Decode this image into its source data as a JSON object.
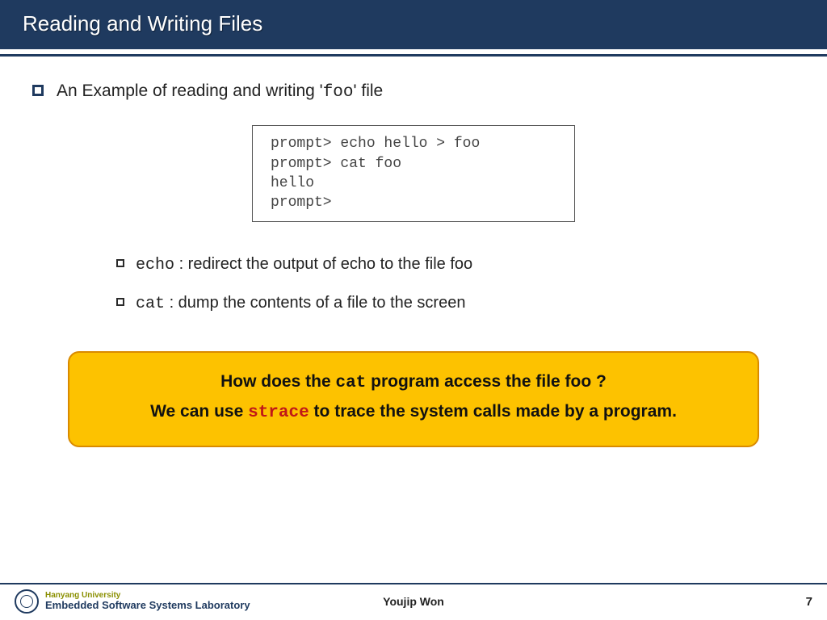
{
  "title": "Reading and Writing Files",
  "bullet": {
    "prefix": "An Example of reading and writing '",
    "code": "foo",
    "suffix": "' file"
  },
  "code_lines": [
    "prompt> echo hello > foo",
    "prompt> cat foo",
    "hello",
    "prompt>"
  ],
  "subs": [
    {
      "cmd": "echo",
      "desc": " : redirect the output of echo to the file foo"
    },
    {
      "cmd": "cat",
      "desc": " : dump the contents of a file to the screen"
    }
  ],
  "callout": {
    "line1_a": "How does the ",
    "line1_code": "cat",
    "line1_b": " program access the file foo ?",
    "line2_a": "We can use ",
    "line2_code": "strace",
    "line2_b": " to trace the system calls made by a program."
  },
  "footer": {
    "university": "Hanyang University",
    "lab": "Embedded Software Systems Laboratory",
    "author": "Youjip Won",
    "page": "7"
  }
}
